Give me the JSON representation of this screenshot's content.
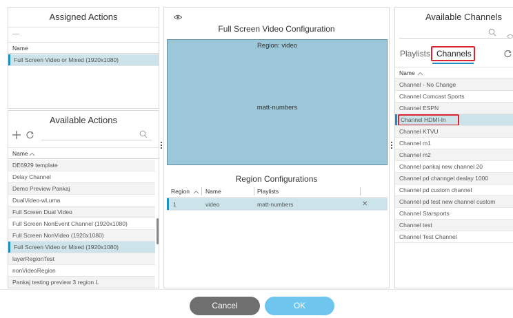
{
  "assigned_actions": {
    "title": "Assigned Actions",
    "minus_symbol": "—",
    "column_header": "Name",
    "rows": [
      "Full Screen Video or Mixed (1920x1080)"
    ]
  },
  "available_actions": {
    "title": "Available Actions",
    "column_header": "Name",
    "rows": [
      "DE6929 template",
      "Delay Channel",
      "Demo Preview Pankaj",
      "DualVideo-wLuma",
      "Full Screen Dual Video",
      "Full Screen NonEvent Channel (1920x1080)",
      "Full Screen NonVideo (1920x1080)",
      "Full Screen Video or Mixed (1920x1080)",
      "layerRegionTest",
      "nonVideoRegion",
      "Pankaj testing preview 3 region L"
    ],
    "selected_index": 7
  },
  "video_config": {
    "title": "Full Screen Video Configuration",
    "region_label": "Region: video",
    "region_content": "matt-numbers",
    "region_color": "#9cc7d8"
  },
  "region_configurations": {
    "title": "Region Configurations",
    "columns": [
      "Region",
      "Name",
      "Playlists"
    ],
    "rows": [
      {
        "region": "1",
        "name": "video",
        "playlists": "matt-numbers",
        "remove": "✕"
      }
    ]
  },
  "available_channels": {
    "title": "Available Channels",
    "tabs": [
      "Playlists",
      "Channels"
    ],
    "active_tab": "Channels",
    "column_header": "Name",
    "rows": [
      "Channel - No Change",
      "Channel Comcast Sports",
      "Channel ESPN",
      "Channel HDMI-In",
      "Channel KTVU",
      "Channel m1",
      "Channel m2",
      "Channel pankaj new channel 20",
      "Channel pd channgel dealay 1000",
      "Channel pd custom channel",
      "Channel pd test new channel custom",
      "Channel Starsports",
      "Channel test",
      "Channel Test Channel"
    ],
    "selected_index": 3
  },
  "footer": {
    "cancel_label": "Cancel",
    "ok_label": "OK",
    "cancel_color": "#6f6f6f",
    "ok_color": "#6ec6ee"
  },
  "colors": {
    "accent": "#1f8fc2",
    "highlight_box": "#d9232e"
  }
}
